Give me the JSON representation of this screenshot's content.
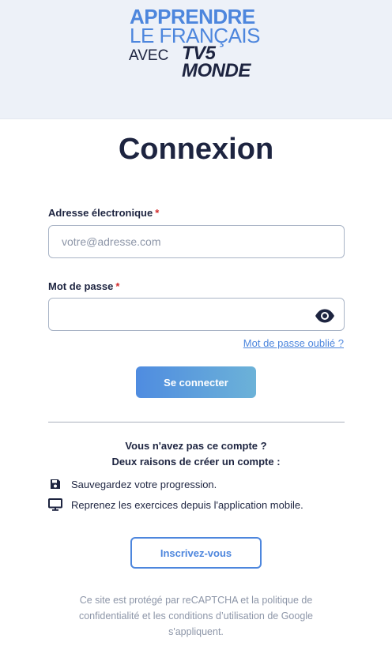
{
  "logo": {
    "line1": "APPRENDRE",
    "line2": "LE FRANÇAIS",
    "avec": "AVEC",
    "brand_top": "TV5",
    "brand_bottom": "MONDE"
  },
  "page": {
    "title": "Connexion"
  },
  "form": {
    "email_label": "Adresse électronique",
    "email_required": "*",
    "email_placeholder": "votre@adresse.com",
    "email_value": "",
    "password_label": "Mot de passe",
    "password_required": "*",
    "password_value": "",
    "forgot_link": "Mot de passe oublié ?",
    "submit_label": "Se connecter"
  },
  "signup": {
    "question": "Vous n'avez pas ce compte ?",
    "heading": "Deux raisons de créer un compte :",
    "reasons": [
      {
        "icon": "floppy-disk-icon",
        "text": "Sauvegardez votre progression."
      },
      {
        "icon": "monitor-icon",
        "text": "Reprenez les exercices depuis l'application mobile."
      }
    ],
    "button_label": "Inscrivez-vous"
  },
  "footer": {
    "recaptcha_notice": "Ce site est protégé par reCAPTCHA et la politique de confidentialité et les conditions d’utilisation de Google s'appliquent."
  },
  "colors": {
    "accent": "#4d86dd",
    "text": "#1d2440",
    "header_bg": "#edf1f8",
    "muted": "#8d96a8",
    "required": "#d12b2b"
  }
}
